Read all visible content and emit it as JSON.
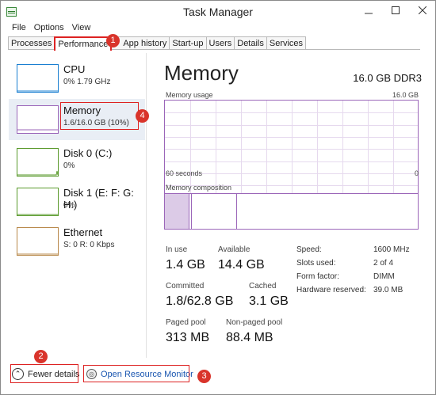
{
  "window": {
    "title": "Task Manager"
  },
  "menu": [
    "File",
    "Options",
    "View"
  ],
  "tabs": [
    "Processes",
    "Performance",
    "App history",
    "Start-up",
    "Users",
    "Details",
    "Services"
  ],
  "callouts": [
    "1",
    "2",
    "3",
    "4"
  ],
  "sidebar": [
    {
      "name": "CPU",
      "sub": "0%  1.79 GHz",
      "color": "#1a7fd1"
    },
    {
      "name": "Memory",
      "sub": "1.6/16.0 GB (10%)",
      "color": "#9b66b9"
    },
    {
      "name": "Disk 0 (C:)",
      "sub": "0%",
      "color": "#5a9a2c"
    },
    {
      "name": "Disk 1 (E: F: G: H:)",
      "sub": "0%",
      "color": "#5a9a2c"
    },
    {
      "name": "Ethernet",
      "sub": "S: 0  R: 0 Kbps",
      "color": "#b8884a"
    }
  ],
  "main": {
    "title": "Memory",
    "spec": "16.0 GB DDR3",
    "usage_label": "Memory usage",
    "usage_max": "16.0 GB",
    "time_label": "60 seconds",
    "usage_zero": "0",
    "composition_label": "Memory composition",
    "stats": {
      "in_use_label": "In use",
      "in_use": "1.4 GB",
      "available_label": "Available",
      "available": "14.4 GB",
      "committed_label": "Committed",
      "committed": "1.8/62.8 GB",
      "cached_label": "Cached",
      "cached": "3.1 GB",
      "paged_label": "Paged pool",
      "paged": "313 MB",
      "nonpaged_label": "Non-paged pool",
      "nonpaged": "88.4 MB"
    },
    "details": [
      {
        "k": "Speed:",
        "v": "1600 MHz"
      },
      {
        "k": "Slots used:",
        "v": "2 of 4"
      },
      {
        "k": "Form factor:",
        "v": "DIMM"
      },
      {
        "k": "Hardware reserved:",
        "v": "39.0 MB"
      }
    ]
  },
  "footer": {
    "fewer": "Fewer details",
    "orm": "Open Resource Monitor"
  },
  "colors": {
    "accent": "#d22",
    "memory": "#9b66b9"
  }
}
